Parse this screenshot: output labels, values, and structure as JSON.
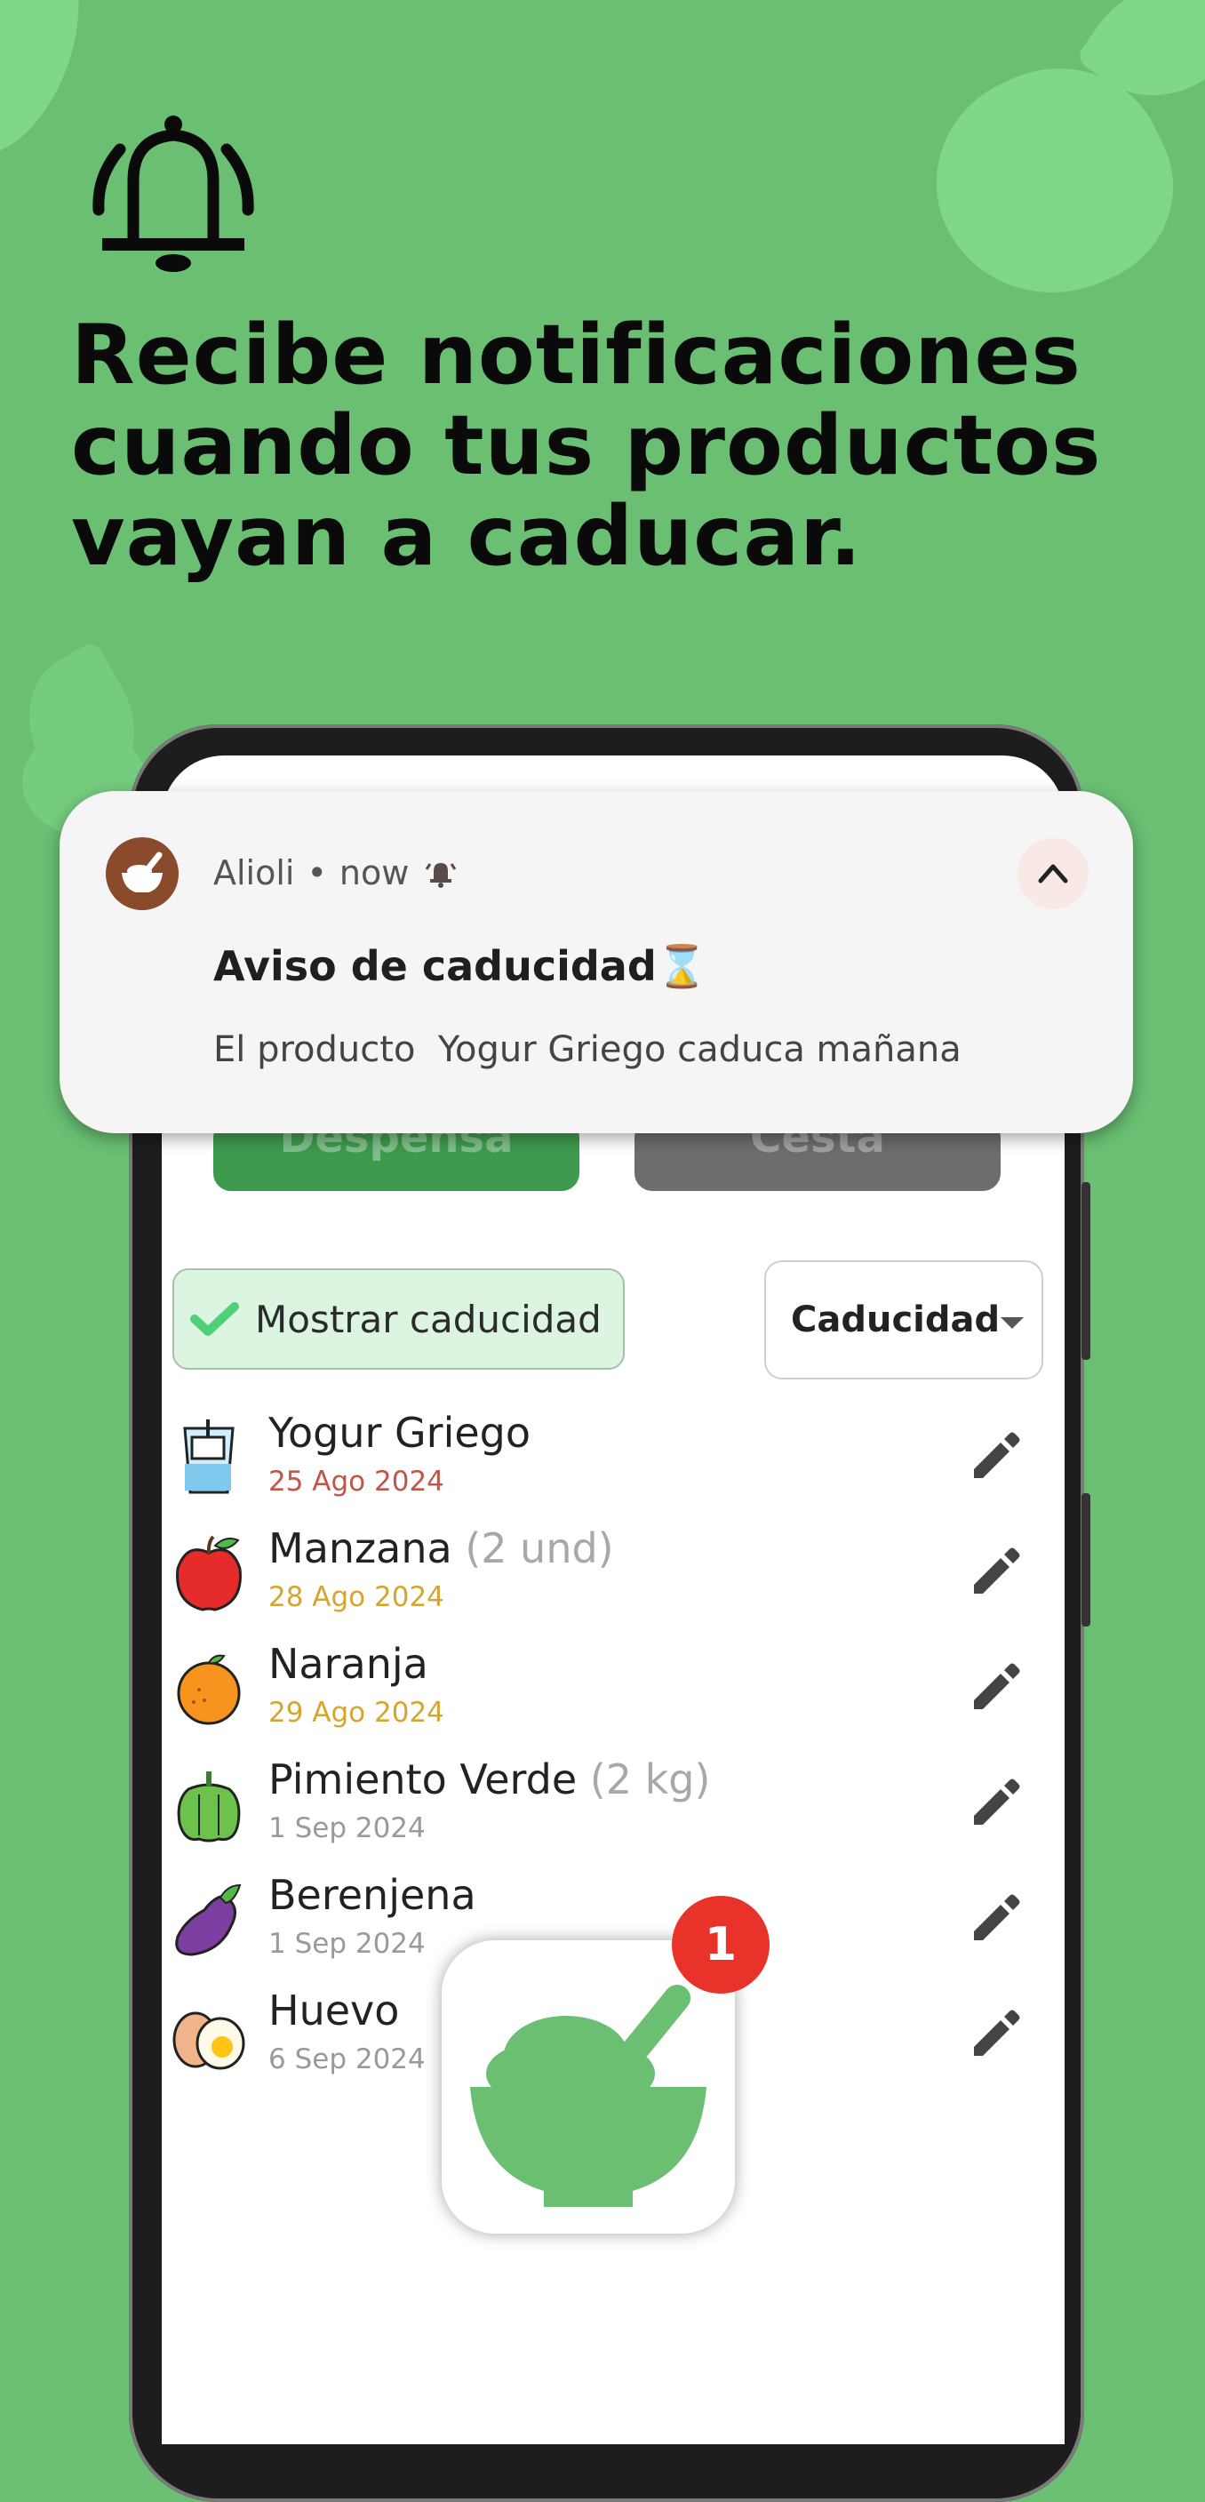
{
  "headline": {
    "line1": "Recibe notificaciones",
    "line2": "cuando tus productos",
    "line3": "vayan a caducar."
  },
  "tabs": [
    {
      "label": "Despensa",
      "color": "#3e9b4d"
    },
    {
      "label": "Cesta",
      "color": "#6d6d6d"
    }
  ],
  "filter": {
    "show_expiry_label": "Mostrar caducidad",
    "checked": true
  },
  "sort": {
    "selected": "Caducidad"
  },
  "items": [
    {
      "name": "Yogur Griego",
      "qty": "",
      "date": "25 Ago 2024",
      "date_color": "#c0564a",
      "icon": "yogurt-icon"
    },
    {
      "name": "Manzana",
      "qty": "(2 und)",
      "date": "28 Ago 2024",
      "date_color": "#d6a531",
      "icon": "apple-icon"
    },
    {
      "name": "Naranja",
      "qty": "",
      "date": "29 Ago 2024",
      "date_color": "#d6a531",
      "icon": "orange-icon"
    },
    {
      "name": "Pimiento Verde",
      "qty": "(2 kg)",
      "date": "1 Sep 2024",
      "date_color": "#9a9a9a",
      "icon": "green-pepper-icon"
    },
    {
      "name": "Berenjena",
      "qty": "",
      "date": "1 Sep 2024",
      "date_color": "#9a9a9a",
      "icon": "eggplant-icon"
    },
    {
      "name": "Huevo",
      "qty": "",
      "date": "6 Sep 2024",
      "date_color": "#9a9a9a",
      "icon": "egg-icon"
    }
  ],
  "notification": {
    "app_name": "Alioli",
    "time": "now",
    "title": "Aviso de caducidad⌛",
    "body": "El producto  Yogur Griego caduca mañana"
  },
  "app_icon": {
    "badge_count": "1"
  }
}
